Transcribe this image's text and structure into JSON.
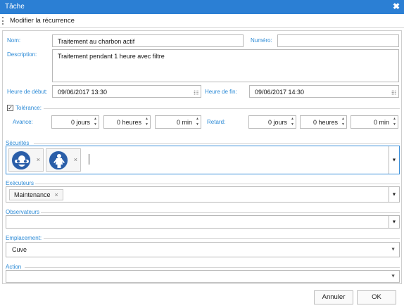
{
  "window": {
    "title": "Tâche",
    "close_glyph": "✖"
  },
  "toolbar": {
    "modify_recurrence": "Modifier la récurrence"
  },
  "form": {
    "name_label": "Nom:",
    "name_value": "Traitement au charbon actif",
    "number_label": "Numéro:",
    "number_value": "",
    "description_label": "Description:",
    "description_value": "Traitement pendant 1 heure avec filtre",
    "start_label": "Heure de début:",
    "start_value": "09/06/2017 13:30",
    "end_label": "Heure de fin:",
    "end_value": "09/06/2017 14:30",
    "tolerance_label": "Tolérance:",
    "tolerance_checked": true,
    "advance_label": "Avance:",
    "advance": {
      "days": "0 jours",
      "hours": "0 heures",
      "minutes": "0 min"
    },
    "delay_label": "Retard:",
    "delay": {
      "days": "0 jours",
      "hours": "0 heures",
      "minutes": "0 min"
    }
  },
  "securities": {
    "label": "Sécurités",
    "items": [
      {
        "icon": "goggles-mask-safety-icon"
      },
      {
        "icon": "protective-suit-safety-icon"
      }
    ]
  },
  "executors": {
    "label": "Exécuteurs",
    "items": [
      "Maintenance"
    ]
  },
  "observers": {
    "label": "Observateurs",
    "items": []
  },
  "location": {
    "label": "Emplacement:",
    "value": "Cuve"
  },
  "action": {
    "label": "Action",
    "value": ""
  },
  "buttons": {
    "cancel": "Annuler",
    "ok": "OK"
  },
  "colors": {
    "titlebar": "#2b7fd4",
    "label_blue": "#2b8ad6",
    "safety_blue": "#2a5ea8"
  }
}
